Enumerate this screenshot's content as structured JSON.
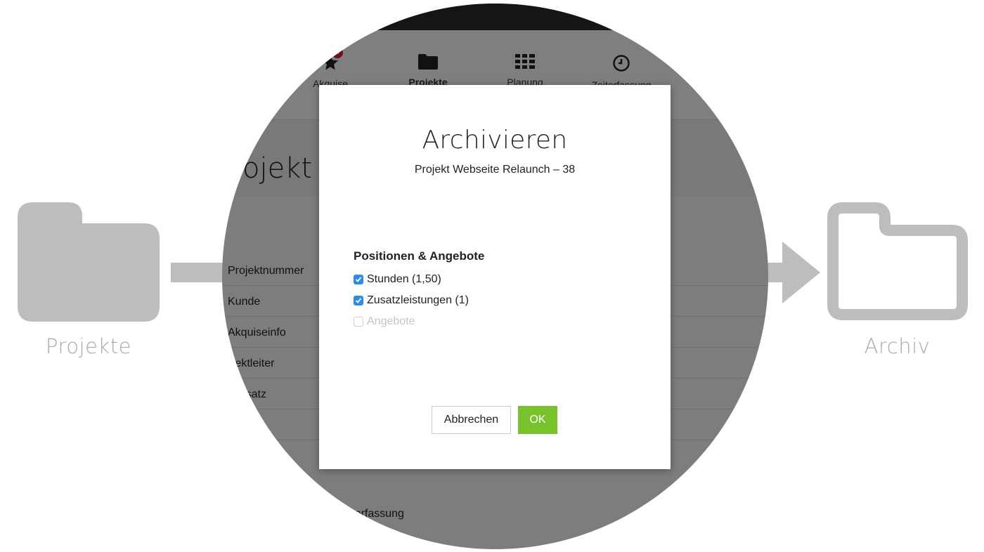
{
  "illustration": {
    "source_label": "Projekte",
    "target_label": "Archiv"
  },
  "app": {
    "nav": [
      {
        "label": "Akquise",
        "icon": "star-icon",
        "badge": "4"
      },
      {
        "label": "Projekte",
        "icon": "folder-icon"
      },
      {
        "label": "Planung",
        "icon": "grid-icon"
      },
      {
        "label": "Zeiterfassung",
        "icon": "clock-icon"
      }
    ],
    "page_title": "Projekt Webseite Relaunch",
    "fields": [
      "Projektnummer",
      "Kunde",
      "Akquiseinfo",
      "Projektleiter",
      "Stundensatz"
    ],
    "bottom_link": "Zeiterfassung"
  },
  "modal": {
    "title": "Archivieren",
    "subtitle": "Projekt Webseite Relaunch – 38",
    "section_heading": "Positionen & Angebote",
    "options": [
      {
        "label": "Stunden (1,50)",
        "checked": true,
        "disabled": false
      },
      {
        "label": "Zusatzleistungen (1)",
        "checked": true,
        "disabled": false
      },
      {
        "label": "Angebote",
        "checked": false,
        "disabled": true
      }
    ],
    "cancel_label": "Abbrechen",
    "ok_label": "OK"
  },
  "colors": {
    "accent_green": "#78c32c",
    "checkbox_blue": "#2a8cf0",
    "illustration_gray": "#bdbdbd"
  }
}
